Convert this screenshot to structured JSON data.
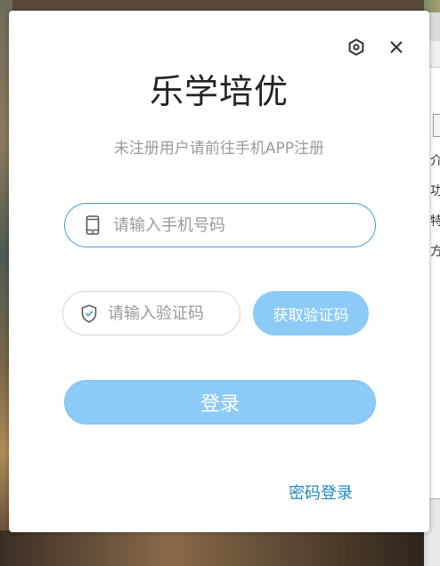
{
  "dialog": {
    "title": "乐学培优",
    "subtitle": "未注册用户请前往手机APP注册",
    "phone_field": {
      "placeholder": "请输入手机号码",
      "value": ""
    },
    "code_field": {
      "placeholder": "请输入验证码",
      "value": ""
    },
    "get_code_label": "获取验证码",
    "login_label": "登录",
    "password_login_label": "密码登录",
    "settings_icon": "settings-icon",
    "close_icon": "close-icon",
    "phone_icon": "phone-icon",
    "shield_icon": "shield-icon"
  },
  "background_window": {
    "glyphs": [
      "介",
      "功",
      "特",
      "方"
    ]
  },
  "colors": {
    "accent": "#8ccaf7",
    "focus_border": "#3aa0d8",
    "link": "#1d88c4",
    "title": "#222222",
    "muted": "#9a9a9a"
  }
}
